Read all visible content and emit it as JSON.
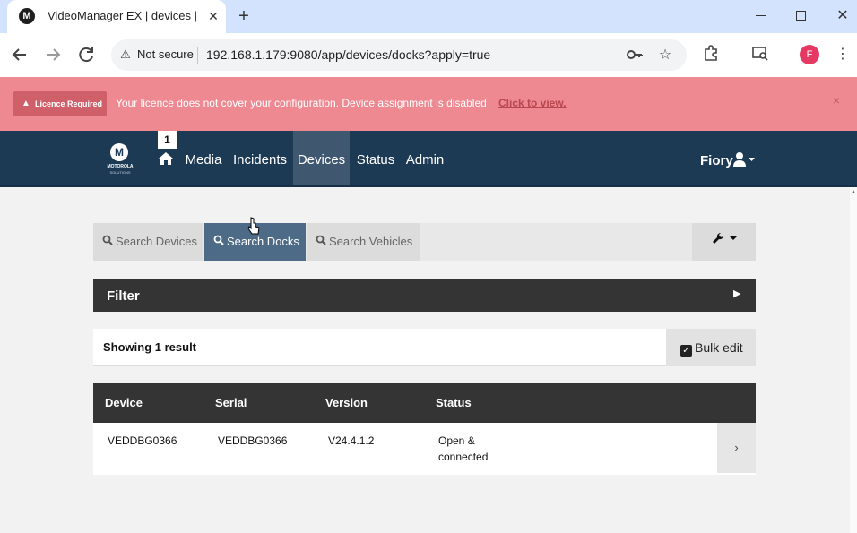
{
  "browser": {
    "tab_title": "VideoManager EX | devices | do",
    "tab_favicon": "M",
    "tab_close": "✕",
    "new_tab": "+",
    "security_icon": "⚠",
    "security_label": "Not secure",
    "url": "192.168.1.179:9080/app/devices/docks?apply=true",
    "profile_initial": "F",
    "win_close": "✕"
  },
  "licence": {
    "badge": "Licence Required",
    "message": "Your licence does not cover your configuration. Device assignment is disabled",
    "link": "Click to view.",
    "close": "×"
  },
  "nav": {
    "logo_letter": "M",
    "logo_text": "MOTOROLA",
    "logo_sub": "SOLUTIONS",
    "notification_count": "1",
    "items": [
      "Media",
      "Incidents",
      "Devices",
      "Status",
      "Admin"
    ],
    "active": "Devices",
    "user_name": "Fiory"
  },
  "search_tabs": {
    "devices": "Search Devices",
    "docks": "Search Docks",
    "vehicles": "Search Vehicles",
    "active": "Search Docks"
  },
  "filter": {
    "label": "Filter"
  },
  "results": {
    "label": "Showing 1 result",
    "bulk_edit": "Bulk edit"
  },
  "table": {
    "headers": [
      "Device",
      "Serial",
      "Version",
      "Status"
    ],
    "rows": [
      {
        "device": "VEDDBG0366",
        "serial": "VEDDBG0366",
        "version": "V24.4.1.2",
        "status": "Open & connected"
      }
    ]
  },
  "colors": {
    "nav_bg": "#1d3a55",
    "nav_active": "#3f5870",
    "banner_bg": "#ef8991",
    "active_tab": "#4d6b87",
    "dark_header": "#343434"
  }
}
